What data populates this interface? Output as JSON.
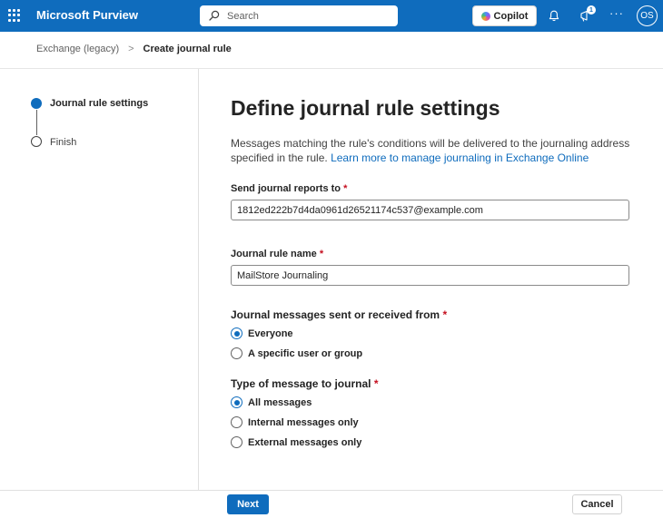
{
  "topbar": {
    "app_name": "Microsoft Purview",
    "search_placeholder": "Search",
    "copilot_label": "Copilot",
    "notification_badge": "1",
    "more_label": "···",
    "avatar_initials": "OS",
    "accent_color": "#0f6cbd"
  },
  "breadcrumb": {
    "parent": "Exchange (legacy)",
    "separator": ">",
    "current": "Create journal rule"
  },
  "stepper": {
    "steps": [
      {
        "label": "Journal rule settings",
        "active": true
      },
      {
        "label": "Finish",
        "active": false
      }
    ]
  },
  "main": {
    "title": "Define journal rule settings",
    "description": "Messages matching the rule's conditions will be delivered to the journaling address specified in the rule.",
    "learn_more_link": "Learn more to manage journaling in Exchange Online",
    "send_reports": {
      "label": "Send journal reports to",
      "required_mark": "*",
      "value": "1812ed222b7d4da0961d26521174c537@example.com"
    },
    "rule_name": {
      "label": "Journal rule name",
      "required_mark": "*",
      "value": "MailStore Journaling"
    },
    "sent_or_received": {
      "label": "Journal messages sent or received from",
      "required_mark": "*",
      "options": [
        "Everyone",
        "A specific user or group"
      ],
      "selected": "Everyone"
    },
    "message_type": {
      "label": "Type of message to journal",
      "required_mark": "*",
      "options": [
        "All messages",
        "Internal messages only",
        "External messages only"
      ],
      "selected": "All messages"
    }
  },
  "footer": {
    "next_label": "Next",
    "cancel_label": "Cancel"
  }
}
